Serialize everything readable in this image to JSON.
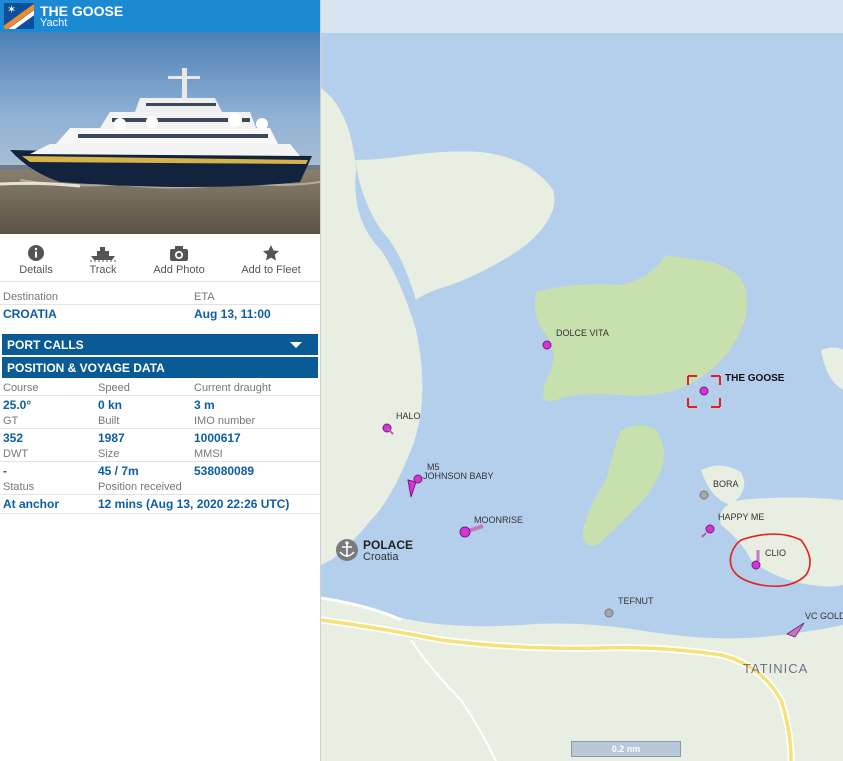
{
  "vessel": {
    "name": "THE GOOSE",
    "type": "Yacht"
  },
  "actions": [
    {
      "label": "Details",
      "icon": "info-icon"
    },
    {
      "label": "Track",
      "icon": "ship-track-icon"
    },
    {
      "label": "Add Photo",
      "icon": "camera-icon"
    },
    {
      "label": "Add to Fleet",
      "icon": "star-icon"
    }
  ],
  "voyage": {
    "destination_label": "Destination",
    "destination": "CROATIA",
    "eta_label": "ETA",
    "eta": "Aug 13, 11:00"
  },
  "sections": {
    "port_calls": "PORT CALLS",
    "position_voyage": "POSITION & VOYAGE DATA"
  },
  "details": {
    "course_label": "Course",
    "course": "25.0°",
    "speed_label": "Speed",
    "speed": "0 kn",
    "draught_label": "Current draught",
    "draught": "3 m",
    "gt_label": "GT",
    "gt": "352",
    "built_label": "Built",
    "built": "1987",
    "imo_label": "IMO number",
    "imo": "1000617",
    "dwt_label": "DWT",
    "dwt": "-",
    "size_label": "Size",
    "size": "45 / 7m",
    "mmsi_label": "MMSI",
    "mmsi": "538080089",
    "status_label": "Status",
    "status": "At anchor",
    "position_label": "Position received",
    "position": "12 mins (Aug 13, 2020 22:26 UTC)"
  },
  "map": {
    "vessels": [
      "DOLCE VITA",
      "THE GOOSE",
      "HALO",
      "M5",
      "JOHNSON BABY",
      "MOONRISE",
      "BORA",
      "HAPPY ME",
      "CLIO",
      "TEFNUT",
      "VC GOLD"
    ],
    "port_name": "POLACE",
    "port_country": "Croatia",
    "place": "TATINICA",
    "scale": "0.2 nm"
  },
  "colors": {
    "header": "#1b8ad3",
    "section_band": "#0a5a96",
    "value_text": "#0c5da5",
    "water": "#b4cfec",
    "land": "#e9eee2",
    "island": "#c8dfae",
    "vessel_marker": "#d633d6"
  }
}
